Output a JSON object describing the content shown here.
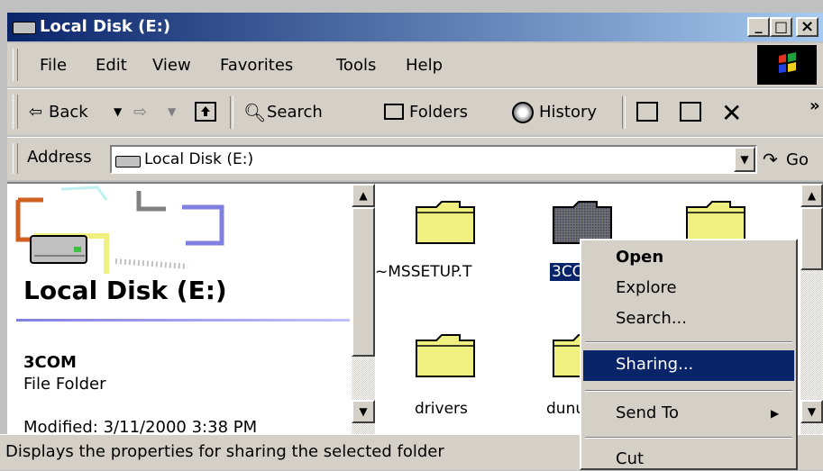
{
  "window": {
    "title": "Local Disk (E:)",
    "controls": {
      "minimize": "_",
      "maximize": "□",
      "close": "×"
    }
  },
  "menubar": {
    "items": [
      "File",
      "Edit",
      "View",
      "Favorites",
      "Tools",
      "Help"
    ]
  },
  "toolbar": {
    "back_label": "Back",
    "search_label": "Search",
    "folders_label": "Folders",
    "history_label": "History",
    "chevron": "»"
  },
  "address": {
    "label": "Address",
    "value": "Local Disk (E:)",
    "go_label": "Go"
  },
  "left_pane": {
    "drive_title": "Local Disk (E:)",
    "selected_name": "3COM",
    "selected_type": "File Folder",
    "modified_text": "Modified: 3/11/2000 3:38 PM"
  },
  "files": {
    "items": [
      {
        "label": "~MSSETUP.T"
      },
      {
        "label": "3COM"
      },
      {
        "label": ""
      },
      {
        "label": "drivers"
      },
      {
        "label": "dunu"
      }
    ]
  },
  "context_menu": {
    "items": [
      "Open",
      "Explore",
      "Search...",
      "Sharing...",
      "Send To",
      "Cut"
    ],
    "submenu_arrow": "▶"
  },
  "status_bar": {
    "text": "Displays the properties for sharing the selected folder"
  },
  "colors": {
    "titlebar_start": "#0a246a",
    "titlebar_end": "#a6caf0",
    "selection": "#0a246a",
    "folder_yellow": "#f0f080",
    "face": "#d4d0c8"
  },
  "icons": [
    "drive-icon",
    "windows-logo-icon",
    "back-arrow-icon",
    "forward-arrow-icon",
    "up-folder-icon",
    "search-icon",
    "folders-icon",
    "history-icon",
    "move-to-icon",
    "copy-to-icon",
    "delete-icon",
    "go-icon",
    "folder-icon"
  ]
}
